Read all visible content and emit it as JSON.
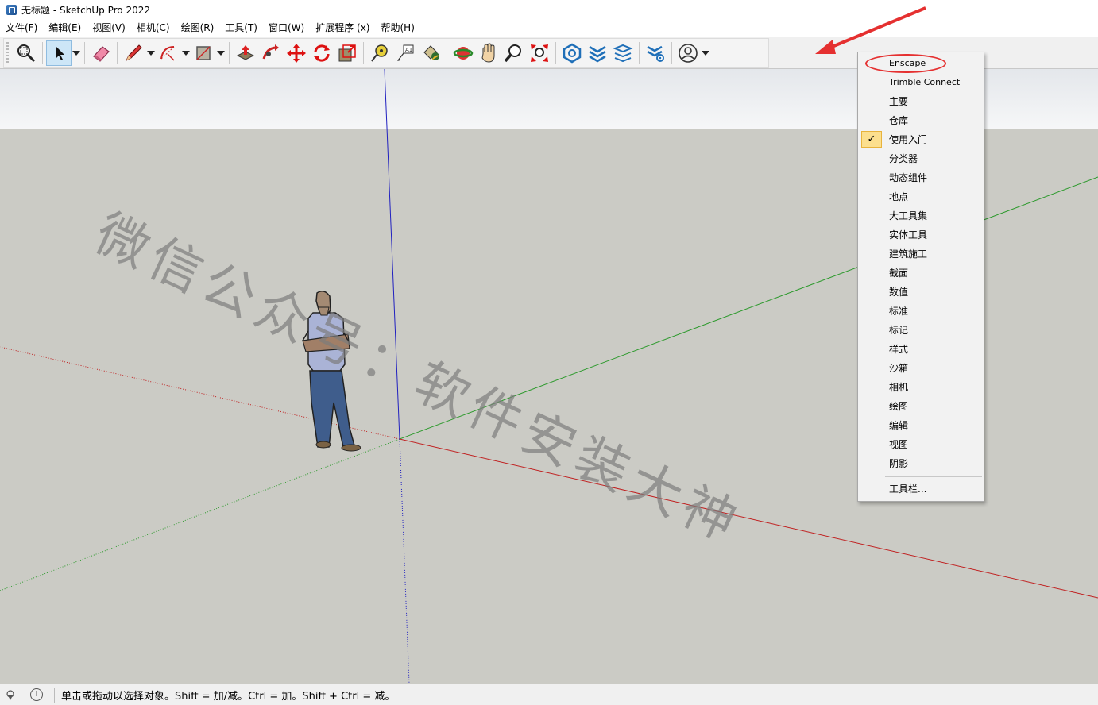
{
  "window": {
    "title": "无标题 - SketchUp Pro 2022"
  },
  "menubar": {
    "items": [
      "文件(F)",
      "编辑(E)",
      "视图(V)",
      "相机(C)",
      "绘图(R)",
      "工具(T)",
      "窗口(W)",
      "扩展程序 (x)",
      "帮助(H)"
    ]
  },
  "toolbar": {
    "icons": [
      "zoom-window-icon",
      "select-icon",
      "eraser-icon",
      "line-tool-icon",
      "arc-tool-icon",
      "rectangle-tool-icon",
      "push-pull-icon",
      "follow-me-icon",
      "move-icon",
      "rotate-icon",
      "scale-icon",
      "tape-measure-icon",
      "text-tool-icon",
      "paint-bucket-icon",
      "orbit-icon",
      "pan-icon",
      "zoom-icon",
      "zoom-extents-icon",
      "enscape-start-icon",
      "enscape-sync-icon",
      "enscape-views-icon",
      "enscape-settings-icon",
      "account-icon"
    ]
  },
  "context_menu": {
    "items": [
      {
        "label": "Enscape",
        "checked": false
      },
      {
        "label": "Trimble Connect",
        "checked": false
      },
      {
        "label": "主要",
        "checked": false
      },
      {
        "label": "仓库",
        "checked": false
      },
      {
        "label": "使用入门",
        "checked": true
      },
      {
        "label": "分类器",
        "checked": false
      },
      {
        "label": "动态组件",
        "checked": false
      },
      {
        "label": "地点",
        "checked": false
      },
      {
        "label": "大工具集",
        "checked": false
      },
      {
        "label": "实体工具",
        "checked": false
      },
      {
        "label": "建筑施工",
        "checked": false
      },
      {
        "label": "截面",
        "checked": false
      },
      {
        "label": "数值",
        "checked": false
      },
      {
        "label": "标准",
        "checked": false
      },
      {
        "label": "标记",
        "checked": false
      },
      {
        "label": "样式",
        "checked": false
      },
      {
        "label": "沙箱",
        "checked": false
      },
      {
        "label": "相机",
        "checked": false
      },
      {
        "label": "绘图",
        "checked": false
      },
      {
        "label": "编辑",
        "checked": false
      },
      {
        "label": "视图",
        "checked": false
      },
      {
        "label": "阴影",
        "checked": false
      }
    ],
    "footer_label": "工具栏...",
    "check_glyph": "✓"
  },
  "watermark": {
    "text": "微信公众号：软件安装大神"
  },
  "statusbar": {
    "info_glyph": "i",
    "hint_text": "单击或拖动以选择对象。Shift = 加/减。Ctrl = 加。Shift + Ctrl = 减。"
  },
  "colors": {
    "sky_top": "#e4e7eb",
    "sky_bottom": "#f6f7f8",
    "ground": "#cbcbc5",
    "axis_red": "#c02020",
    "axis_green": "#2d9a2d",
    "axis_blue": "#2020c0",
    "annotation_red": "#e53030",
    "check_bg": "#fcdf8e"
  }
}
